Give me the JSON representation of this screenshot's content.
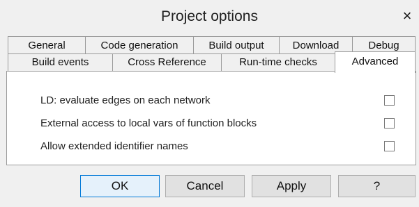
{
  "window": {
    "title": "Project options",
    "close_symbol": "×"
  },
  "tabs": {
    "row1": [
      "General",
      "Code generation",
      "Build output",
      "Download",
      "Debug"
    ],
    "row2": [
      "Build events",
      "Cross Reference",
      "Run-time checks",
      "Advanced"
    ],
    "active": "Advanced"
  },
  "options": [
    {
      "label": "LD: evaluate edges on each network",
      "checked": false
    },
    {
      "label": "External access to local vars of function blocks",
      "checked": false
    },
    {
      "label": "Allow extended identifier names",
      "checked": false
    }
  ],
  "buttons": {
    "ok": "OK",
    "cancel": "Cancel",
    "apply": "Apply",
    "help": "?"
  }
}
